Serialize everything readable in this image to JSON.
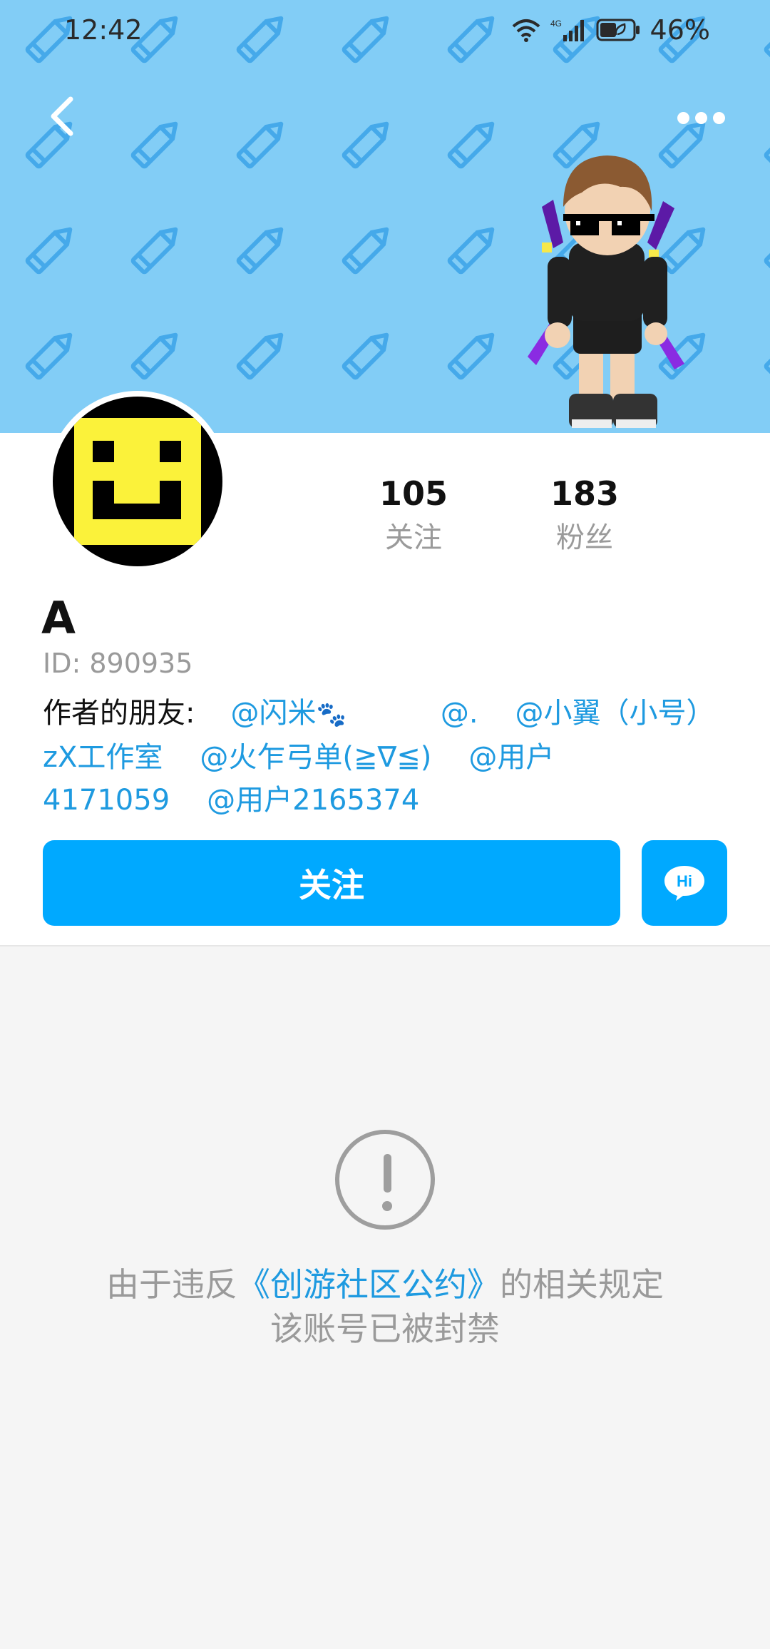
{
  "status_bar": {
    "time": "12:42",
    "network": "4G",
    "battery": "46%"
  },
  "header": {
    "back_icon": "chevron-left-icon",
    "more_icon": "more-dots-icon",
    "background_color": "#82cdf6"
  },
  "profile": {
    "stats": {
      "following_count": "105",
      "following_label": "关注",
      "fans_count": "183",
      "fans_label": "粉丝"
    },
    "username": "A",
    "user_id": "ID: 890935",
    "friends_label": "作者的朋友:",
    "friends": [
      "@闪米",
      "@.",
      "@小翼（小号）zX工作室",
      "@火乍弓单(≧∇≦)",
      "@用户4171059",
      "@用户2165374"
    ]
  },
  "actions": {
    "follow_label": "关注",
    "hi_label": "Hi",
    "accent_color": "#00a9ff"
  },
  "ban_notice": {
    "prefix": "由于违反",
    "rule_link": "《创游社区公约》",
    "suffix": "的相关规定",
    "line2": "该账号已被封禁"
  }
}
